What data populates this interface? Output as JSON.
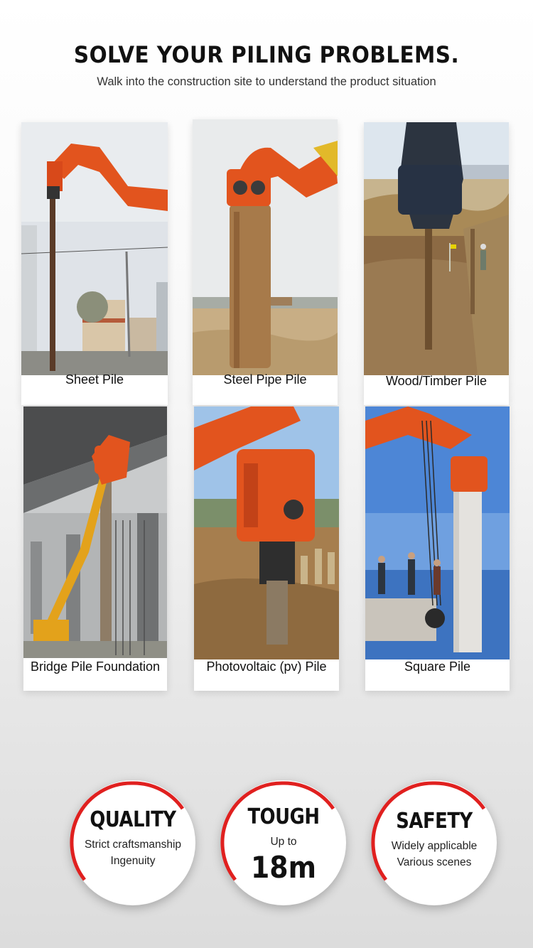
{
  "header": {
    "title": "SOLVE YOUR PILING PROBLEMS.",
    "subtitle": "Walk into the construction site to understand the product situation"
  },
  "pile_types": [
    {
      "label": "Sheet Pile",
      "image": "sheet-pile-photo"
    },
    {
      "label": "Steel Pipe Pile",
      "image": "steel-pipe-pile-photo"
    },
    {
      "label": "Wood/Timber Pile",
      "image": "wood-timber-pile-photo"
    },
    {
      "label": "Bridge Pile Foundation",
      "image": "bridge-pile-foundation-photo"
    },
    {
      "label": "Photovoltaic (pv) Pile",
      "image": "photovoltaic-pile-photo"
    },
    {
      "label": "Square Pile",
      "image": "square-pile-photo"
    }
  ],
  "features": [
    {
      "title": "QUALITY",
      "lines": [
        "Strict craftsmanship",
        "Ingenuity"
      ]
    },
    {
      "title": "TOUGH",
      "lines": [
        "Up to"
      ],
      "highlight": "18m"
    },
    {
      "title": "SAFETY",
      "lines": [
        "Widely applicable",
        "Various scenes"
      ]
    }
  ],
  "colors": {
    "accent": "#e0201f",
    "machine_orange": "#e2541e",
    "text": "#111111"
  }
}
